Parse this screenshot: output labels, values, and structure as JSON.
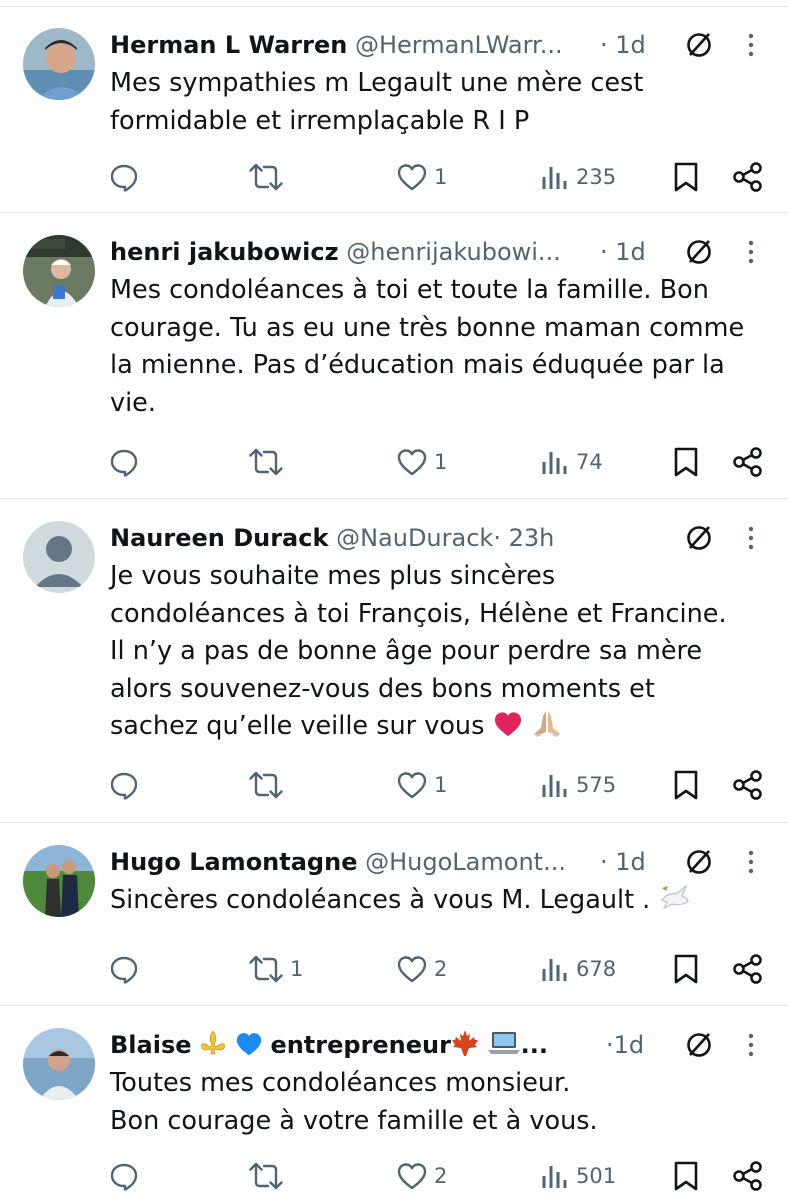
{
  "tweets": [
    {
      "name": "Herman L Warren",
      "handle": "@HermanLWarr...",
      "time": "1d",
      "text": [
        "Mes sympathies m Legault une mère cest",
        "formidable et irremplaçable R I P"
      ],
      "replies": "",
      "reposts": "",
      "likes": "1",
      "views": "235"
    },
    {
      "name": "henri jakubowicz",
      "handle": "@henrijakubowi...",
      "time": "1d",
      "text": [
        "Mes condoléances à toi et toute la famille. Bon",
        "courage. Tu as eu une très bonne maman comme",
        "la mienne. Pas d’éducation mais éduquée par la",
        "vie."
      ],
      "replies": "",
      "reposts": "",
      "likes": "1",
      "views": "74"
    },
    {
      "name": "Naureen Durack",
      "handle": "@NauDurack",
      "time": "23h",
      "text": [
        "Je vous souhaite mes plus sincères",
        "condoléances à toi François, Hélène et Francine.",
        "Il n’y a pas de bonne âge pour perdre sa mère",
        "alors souvenez-vous des bons moments et",
        "sachez qu’elle veille sur vous"
      ],
      "replies": "",
      "reposts": "",
      "likes": "1",
      "views": "575"
    },
    {
      "name": "Hugo Lamontagne",
      "handle": "@HugoLamont...",
      "time": "1d",
      "text": [
        "Sincères condoléances à vous M. Legault ."
      ],
      "replies": "",
      "reposts": "1",
      "likes": "2",
      "views": "678"
    },
    {
      "name_part1": "Blaise",
      "name_part2": "entrepreneur",
      "name_ellipsis": "...",
      "time": "1d",
      "text": [
        "Toutes mes condoléances monsieur.",
        "Bon courage à votre famille et à vous."
      ],
      "replies": "",
      "reposts": "",
      "likes": "2",
      "views": "501"
    }
  ],
  "separator": "·",
  "icons": [
    "reply-icon",
    "repost-icon",
    "like-icon",
    "views-icon",
    "bookmark-icon",
    "share-icon",
    "grok-icon",
    "more-icon"
  ],
  "colors": {
    "text": "#0f1419",
    "secondary": "#536471",
    "divider": "#e6e9ec",
    "heart": "#e0245e"
  }
}
